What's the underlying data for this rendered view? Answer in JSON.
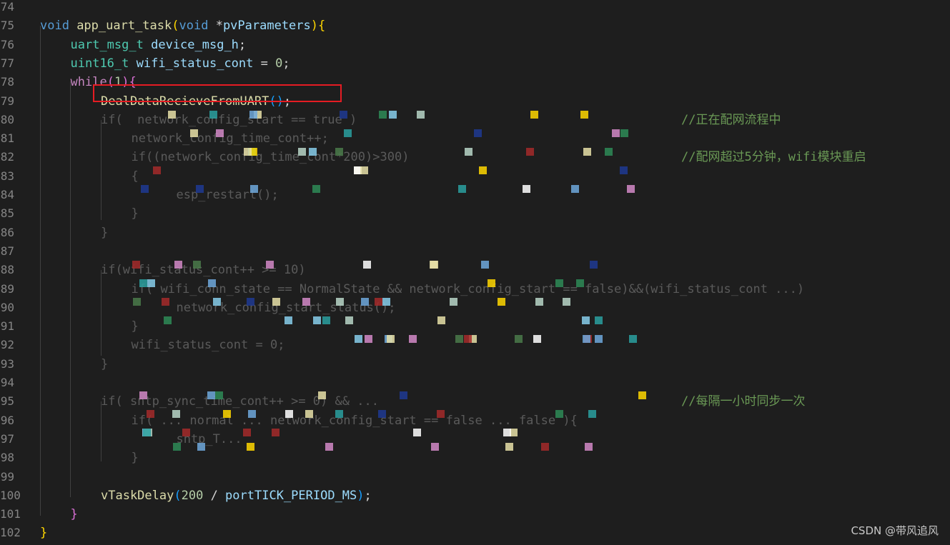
{
  "lines": [
    {
      "n": "74"
    },
    {
      "n": "75",
      "tokens": [
        [
          "kw",
          "void "
        ],
        [
          "fn",
          "app_uart_task"
        ],
        [
          "b1",
          "("
        ],
        [
          "kw",
          "void "
        ],
        [
          "op",
          "*"
        ],
        [
          "var",
          "pvParameters"
        ],
        [
          "b1",
          ")"
        ],
        [
          "b1",
          "{"
        ]
      ]
    },
    {
      "n": "76",
      "tokens": [
        [
          "ty",
          "uart_msg_t "
        ],
        [
          "var",
          "device_msg_h"
        ],
        [
          "op",
          ";"
        ]
      ]
    },
    {
      "n": "77",
      "tokens": [
        [
          "ty",
          "uint16_t "
        ],
        [
          "var",
          "wifi_status_cont"
        ],
        [
          "op",
          " = "
        ],
        [
          "num",
          "0"
        ],
        [
          "op",
          ";"
        ]
      ]
    },
    {
      "n": "78",
      "tokens": [
        [
          "ctrl",
          "while"
        ],
        [
          "b2",
          "("
        ],
        [
          "num",
          "1"
        ],
        [
          "b2",
          ")"
        ],
        [
          "b2",
          "{"
        ]
      ]
    },
    {
      "n": "79",
      "tokens": [
        [
          "fn",
          "DealDataRecieveFromUART"
        ],
        [
          "b3",
          "()"
        ],
        [
          "op",
          ";"
        ]
      ]
    },
    {
      "n": "80",
      "tokens": [
        [
          "obs",
          "if(  network_config_start == true )"
        ]
      ],
      "comment": "//正在配网流程中"
    },
    {
      "n": "81",
      "tokens": [
        [
          "obs",
          "network_config_time_cont++"
        ],
        [
          "obs",
          ";"
        ]
      ]
    },
    {
      "n": "82",
      "tokens": [
        [
          "obs",
          "if((network_config_time_cont*200)>300)"
        ]
      ],
      "comment": "//配网超过5分钟，wifi模块重启"
    },
    {
      "n": "83",
      "tokens": [
        [
          "obs",
          "{"
        ]
      ]
    },
    {
      "n": "84",
      "tokens": [
        [
          "obs",
          "  esp_restart();"
        ]
      ]
    },
    {
      "n": "85",
      "tokens": [
        [
          "obs",
          "}"
        ]
      ]
    },
    {
      "n": "86",
      "tokens": [
        [
          "obs",
          "}"
        ]
      ]
    },
    {
      "n": "87"
    },
    {
      "n": "88",
      "tokens": [
        [
          "obs",
          "if(wifi_status_cont++ >= 10)"
        ]
      ]
    },
    {
      "n": "89",
      "tokens": [
        [
          "obs",
          "if( wifi_conn_state == NormalState && network_config_start == false)&&(wifi_status_cont ...)"
        ]
      ]
    },
    {
      "n": "90",
      "tokens": [
        [
          "obs",
          "  network_config_start_status();"
        ]
      ]
    },
    {
      "n": "91",
      "tokens": [
        [
          "obs",
          "}"
        ]
      ]
    },
    {
      "n": "92",
      "tokens": [
        [
          "obs",
          "wifi_status_cont = 0;"
        ]
      ]
    },
    {
      "n": "93",
      "tokens": [
        [
          "obs",
          "}"
        ]
      ]
    },
    {
      "n": "94"
    },
    {
      "n": "95",
      "tokens": [
        [
          "obs",
          "if( sntp_sync_time_cont++ >= 0) && ... "
        ]
      ],
      "comment": "//每隔一小时同步一次"
    },
    {
      "n": "96",
      "tokens": [
        [
          "obs",
          "if( ... normal ... network_config_start == false ... false ){"
        ]
      ]
    },
    {
      "n": "97",
      "tokens": [
        [
          "obs",
          "  sntp_T..."
        ]
      ]
    },
    {
      "n": "98",
      "tokens": [
        [
          "obs",
          "}"
        ]
      ]
    },
    {
      "n": "99"
    },
    {
      "n": "100",
      "tokens": [
        [
          "fn",
          "vTaskDelay"
        ],
        [
          "b3",
          "("
        ],
        [
          "num",
          "200"
        ],
        [
          "op",
          " / "
        ],
        [
          "var",
          "portTICK_PERIOD_MS"
        ],
        [
          "b3",
          ")"
        ],
        [
          "op",
          ";"
        ]
      ]
    },
    {
      "n": "101",
      "tokens": [
        [
          "b2",
          "}"
        ]
      ]
    },
    {
      "n": "102",
      "tokens": [
        [
          "b1",
          "}"
        ]
      ]
    }
  ],
  "watermark": "CSDN @带风追风"
}
